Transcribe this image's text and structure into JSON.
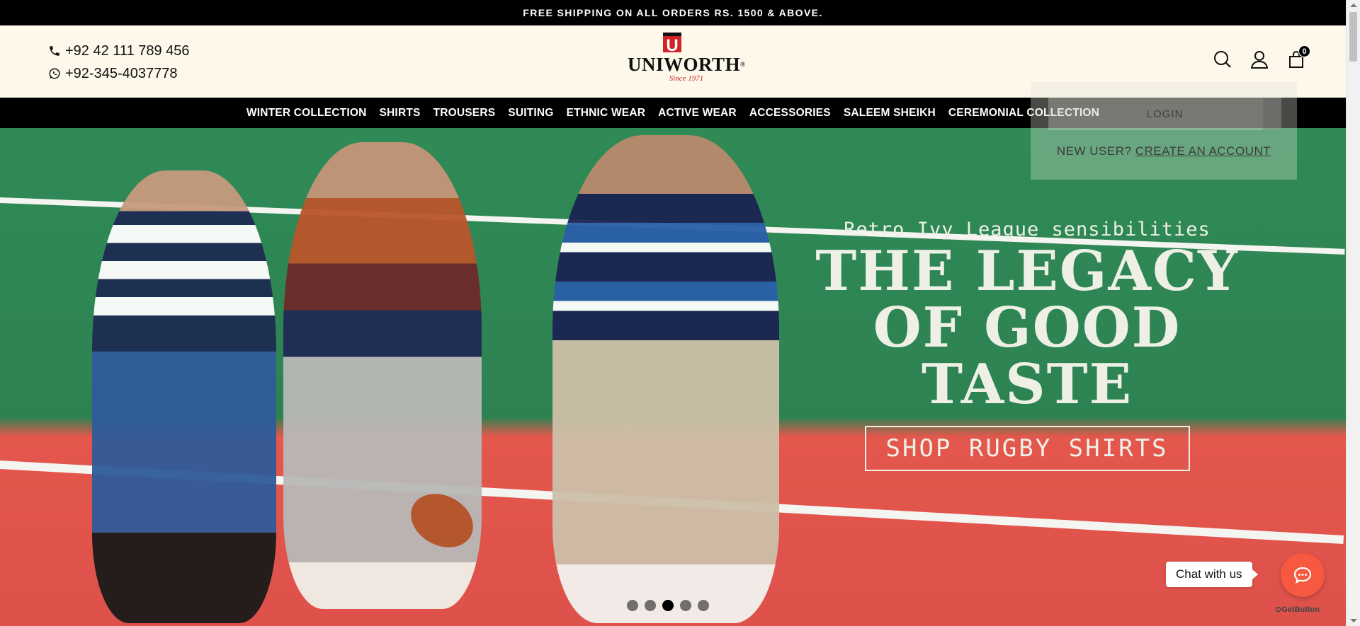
{
  "announcement": "FREE SHIPPING ON ALL ORDERS RS. 1500 & ABOVE.",
  "contacts": {
    "phone": "+92 42 111 789 456",
    "whatsapp": "+92-345-4037778"
  },
  "logo": {
    "letter": "U",
    "word": "UNIWORTH",
    "registered": "®",
    "since": "Since 1971"
  },
  "header_icons": {
    "search": "search-icon",
    "account": "user-icon",
    "cart": "bag-icon",
    "cart_count": "0"
  },
  "nav": {
    "items": [
      "WINTER COLLECTION",
      "SHIRTS",
      "TROUSERS",
      "SUITING",
      "ETHNIC WEAR",
      "ACTIVE WEAR",
      "ACCESSORIES",
      "SALEEM SHEIKH",
      "CEREMONIAL COLLECTION"
    ]
  },
  "hero": {
    "subtitle": "Retro Ivy League sensibilities",
    "title_line1": "THE LEGACY",
    "title_line2": "OF GOOD TASTE",
    "cta": "SHOP RUGBY SHIRTS",
    "slides_total": 5,
    "active_slide": 3
  },
  "login_popup": {
    "login_label": "LOGIN",
    "new_user_text": "NEW USER?",
    "create_account_label": "CREATE AN ACCOUNT"
  },
  "chat": {
    "label": "Chat with us",
    "powered_by": "GetButton"
  },
  "colors": {
    "black": "#000000",
    "header_bg": "#fdf8ea",
    "brand_red": "#d2232a",
    "court_green": "#2e8553",
    "court_red": "#e4574d",
    "chat_orange": "#f6593f"
  }
}
